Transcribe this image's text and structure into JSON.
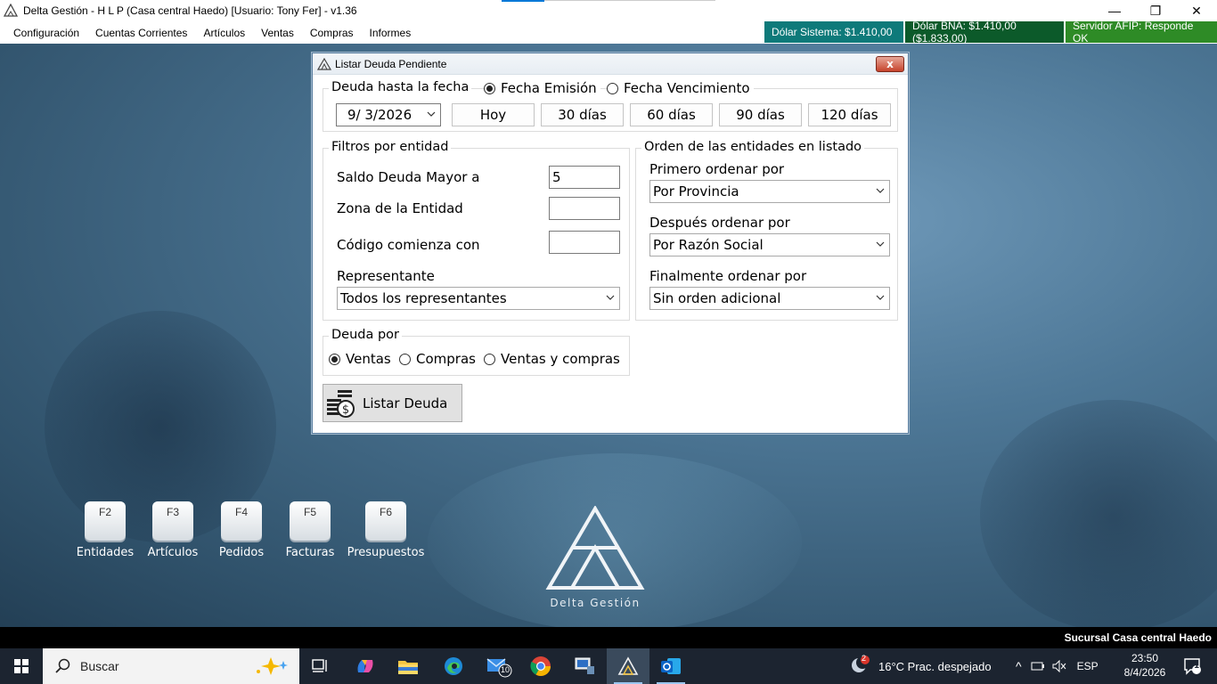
{
  "window": {
    "title": "Delta Gestión - H L P (Casa central Haedo) [Usuario: Tony Fer] - v1.36",
    "minimize": "—",
    "maximize": "❐",
    "close": "✕"
  },
  "menu": [
    "Configuración",
    "Cuentas Corrientes",
    "Artículos",
    "Ventas",
    "Compras",
    "Informes"
  ],
  "status_badges": [
    {
      "text": "Dólar Sistema: $1.410,00",
      "color": "#0e7a7a"
    },
    {
      "text": "Dólar BNA: $1.410,00 ($1.833,00)",
      "color": "#0c5a2a"
    },
    {
      "text": "Servidor AFIP:  Responde OK",
      "color": "#2e8b26"
    }
  ],
  "dialog": {
    "title": "Listar Deuda Pendiente",
    "close_label": "x",
    "date_group": {
      "legend": "Deuda hasta la fecha",
      "radio_emision": "Fecha Emisión",
      "radio_vencimiento": "Fecha Vencimiento",
      "date_value": "9/  3/2026",
      "buttons": [
        "Hoy",
        "30 días",
        "60 días",
        "90 días",
        "120 días"
      ]
    },
    "filters": {
      "legend": "Filtros por entidad",
      "saldo_label": "Saldo Deuda Mayor a",
      "saldo_value": "5",
      "zona_label": "Zona de la Entidad",
      "zona_value": "",
      "codigo_label": "Código comienza con",
      "codigo_value": "",
      "rep_label": "Representante",
      "rep_value": "Todos los representantes"
    },
    "order": {
      "legend": "Orden de las entidades en listado",
      "first_label": "Primero ordenar por",
      "first_value": "Por Provincia",
      "second_label": "Después ordenar por",
      "second_value": "Por Razón Social",
      "final_label": "Finalmente ordenar por",
      "final_value": "Sin orden adicional"
    },
    "deuda_por": {
      "legend": "Deuda por",
      "ventas": "Ventas",
      "compras": "Compras",
      "ventas_compras": "Ventas y compras"
    },
    "list_button": "Listar Deuda"
  },
  "fkeys": [
    {
      "key": "F2",
      "label": "Entidades"
    },
    {
      "key": "F3",
      "label": "Artículos"
    },
    {
      "key": "F4",
      "label": "Pedidos"
    },
    {
      "key": "F5",
      "label": "Facturas"
    },
    {
      "key": "F6",
      "label": "Presupuestos"
    }
  ],
  "logo_text": "Delta Gestión",
  "branch": "Sucursal Casa central Haedo",
  "taskbar": {
    "search_placeholder": "Buscar",
    "mail_badge": "10",
    "teams_badge": "2",
    "weather": "16°C  Prac. despejado",
    "lang": "ESP",
    "time": "23:50",
    "date": "8/4/2026",
    "notif_count": "1"
  }
}
